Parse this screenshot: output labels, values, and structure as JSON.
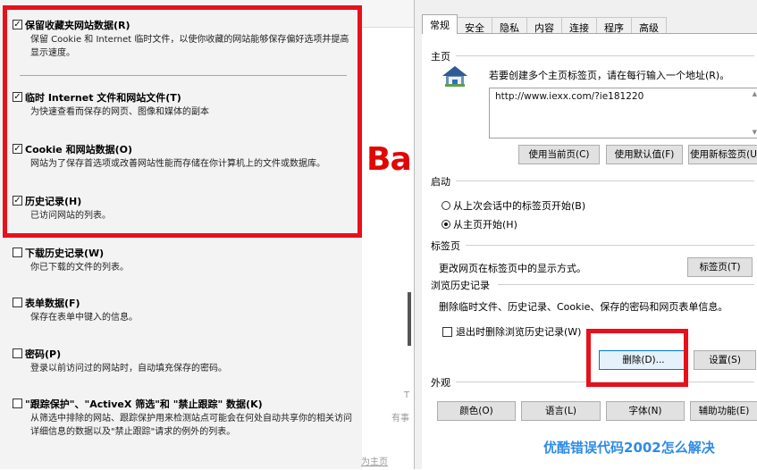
{
  "delete_history": {
    "options": [
      {
        "title": "保留收藏夹网站数据(R)",
        "desc": "保留 Cookie 和 Internet 临时文件，以使你收藏的网站能够保存偏好选项并提高显示速度。",
        "checked": true
      },
      {
        "title": "临时 Internet 文件和网站文件(T)",
        "desc": "为快速查看而保存的网页、图像和媒体的副本",
        "checked": true
      },
      {
        "title": "Cookie 和网站数据(O)",
        "desc": "网站为了保存首选项或改善网站性能而存储在你计算机上的文件或数据库。",
        "checked": true
      },
      {
        "title": "历史记录(H)",
        "desc": "已访问网站的列表。",
        "checked": true
      },
      {
        "title": "下载历史记录(W)",
        "desc": "你已下载的文件的列表。",
        "checked": false
      },
      {
        "title": "表单数据(F)",
        "desc": "保存在表单中键入的信息。",
        "checked": false
      },
      {
        "title": "密码(P)",
        "desc": "登录以前访问过的网站时，自动填充保存的密码。",
        "checked": false
      },
      {
        "title": "\"跟踪保护\"、\"ActiveX 筛选\"和 \"禁止跟踪\" 数据(K)",
        "desc": "从筛选中排除的网站、跟踪保护用来检测站点可能会在何处自动共享你的相关访问详细信息的数据以及\"禁止跟踪\"请求的例外的列表。",
        "checked": false
      }
    ]
  },
  "background_browser": {
    "logo_fragment": "Ba",
    "fragment_t": "T",
    "fragment_you": "有事",
    "fragment_home": "为主页"
  },
  "internet_options": {
    "tabs": [
      "常规",
      "安全",
      "隐私",
      "内容",
      "连接",
      "程序",
      "高级"
    ],
    "home": {
      "group_label": "主页",
      "instruction": "若要创建多个主页标签页，请在每行输入一个地址(R)。",
      "url": "http://www.iexx.com/?ie181220",
      "use_current": "使用当前页(C)",
      "use_default": "使用默认值(F)",
      "use_new_tab": "使用新标签页(U"
    },
    "startup": {
      "group_label": "启动",
      "option_last_session": "从上次会话中的标签页开始(B)",
      "option_home": "从主页开始(H)",
      "selected": "home"
    },
    "tabs_group": {
      "group_label": "标签页",
      "desc": "更改网页在标签页中的显示方式。",
      "button": "标签页(T)"
    },
    "history": {
      "group_label": "浏览历史记录",
      "desc": "删除临时文件、历史记录、Cookie、保存的密码和网页表单信息。",
      "delete_on_exit": "退出时删除浏览历史记录(W)",
      "delete_on_exit_checked": false,
      "delete_button": "删除(D)...",
      "settings_button": "设置(S)"
    },
    "appearance": {
      "group_label": "外观",
      "colors": "颜色(O)",
      "languages": "语言(L)",
      "fonts": "字体(N)",
      "accessibility": "辅助功能(E)"
    }
  },
  "watermark": "优酷错误代码2002怎么解决",
  "colors": {
    "highlight_red": "#e8101a",
    "watermark_blue": "#2e8be6",
    "baidu_red": "#e10602"
  }
}
